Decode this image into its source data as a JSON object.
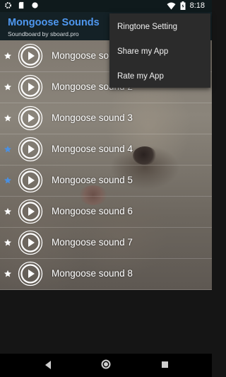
{
  "status_bar": {
    "time": "8:18",
    "icons_left": [
      "gear-icon",
      "sd-card-icon",
      "circle-icon"
    ],
    "icons_right": [
      "wifi-icon",
      "battery-icon"
    ]
  },
  "app_bar": {
    "title": "Mongoose Sounds",
    "subtitle": "Soundboard by sboard.pro",
    "title_color": "#4f98f0"
  },
  "sounds": [
    {
      "label": "Mongoose sound 1",
      "favorite": false
    },
    {
      "label": "Mongoose sound 2",
      "favorite": false
    },
    {
      "label": "Mongoose sound 3",
      "favorite": false
    },
    {
      "label": "Mongoose sound 4",
      "favorite": true
    },
    {
      "label": "Mongoose sound 5",
      "favorite": true
    },
    {
      "label": "Mongoose sound 6",
      "favorite": false
    },
    {
      "label": "Mongoose sound 7",
      "favorite": false
    },
    {
      "label": "Mongoose sound 8",
      "favorite": false
    }
  ],
  "overflow_menu": {
    "items": [
      "Ringtone Setting",
      "Share my App",
      "Rate my App"
    ]
  },
  "colors": {
    "favorite_star": "#4a90e2",
    "normal_star": "#ffffff"
  }
}
